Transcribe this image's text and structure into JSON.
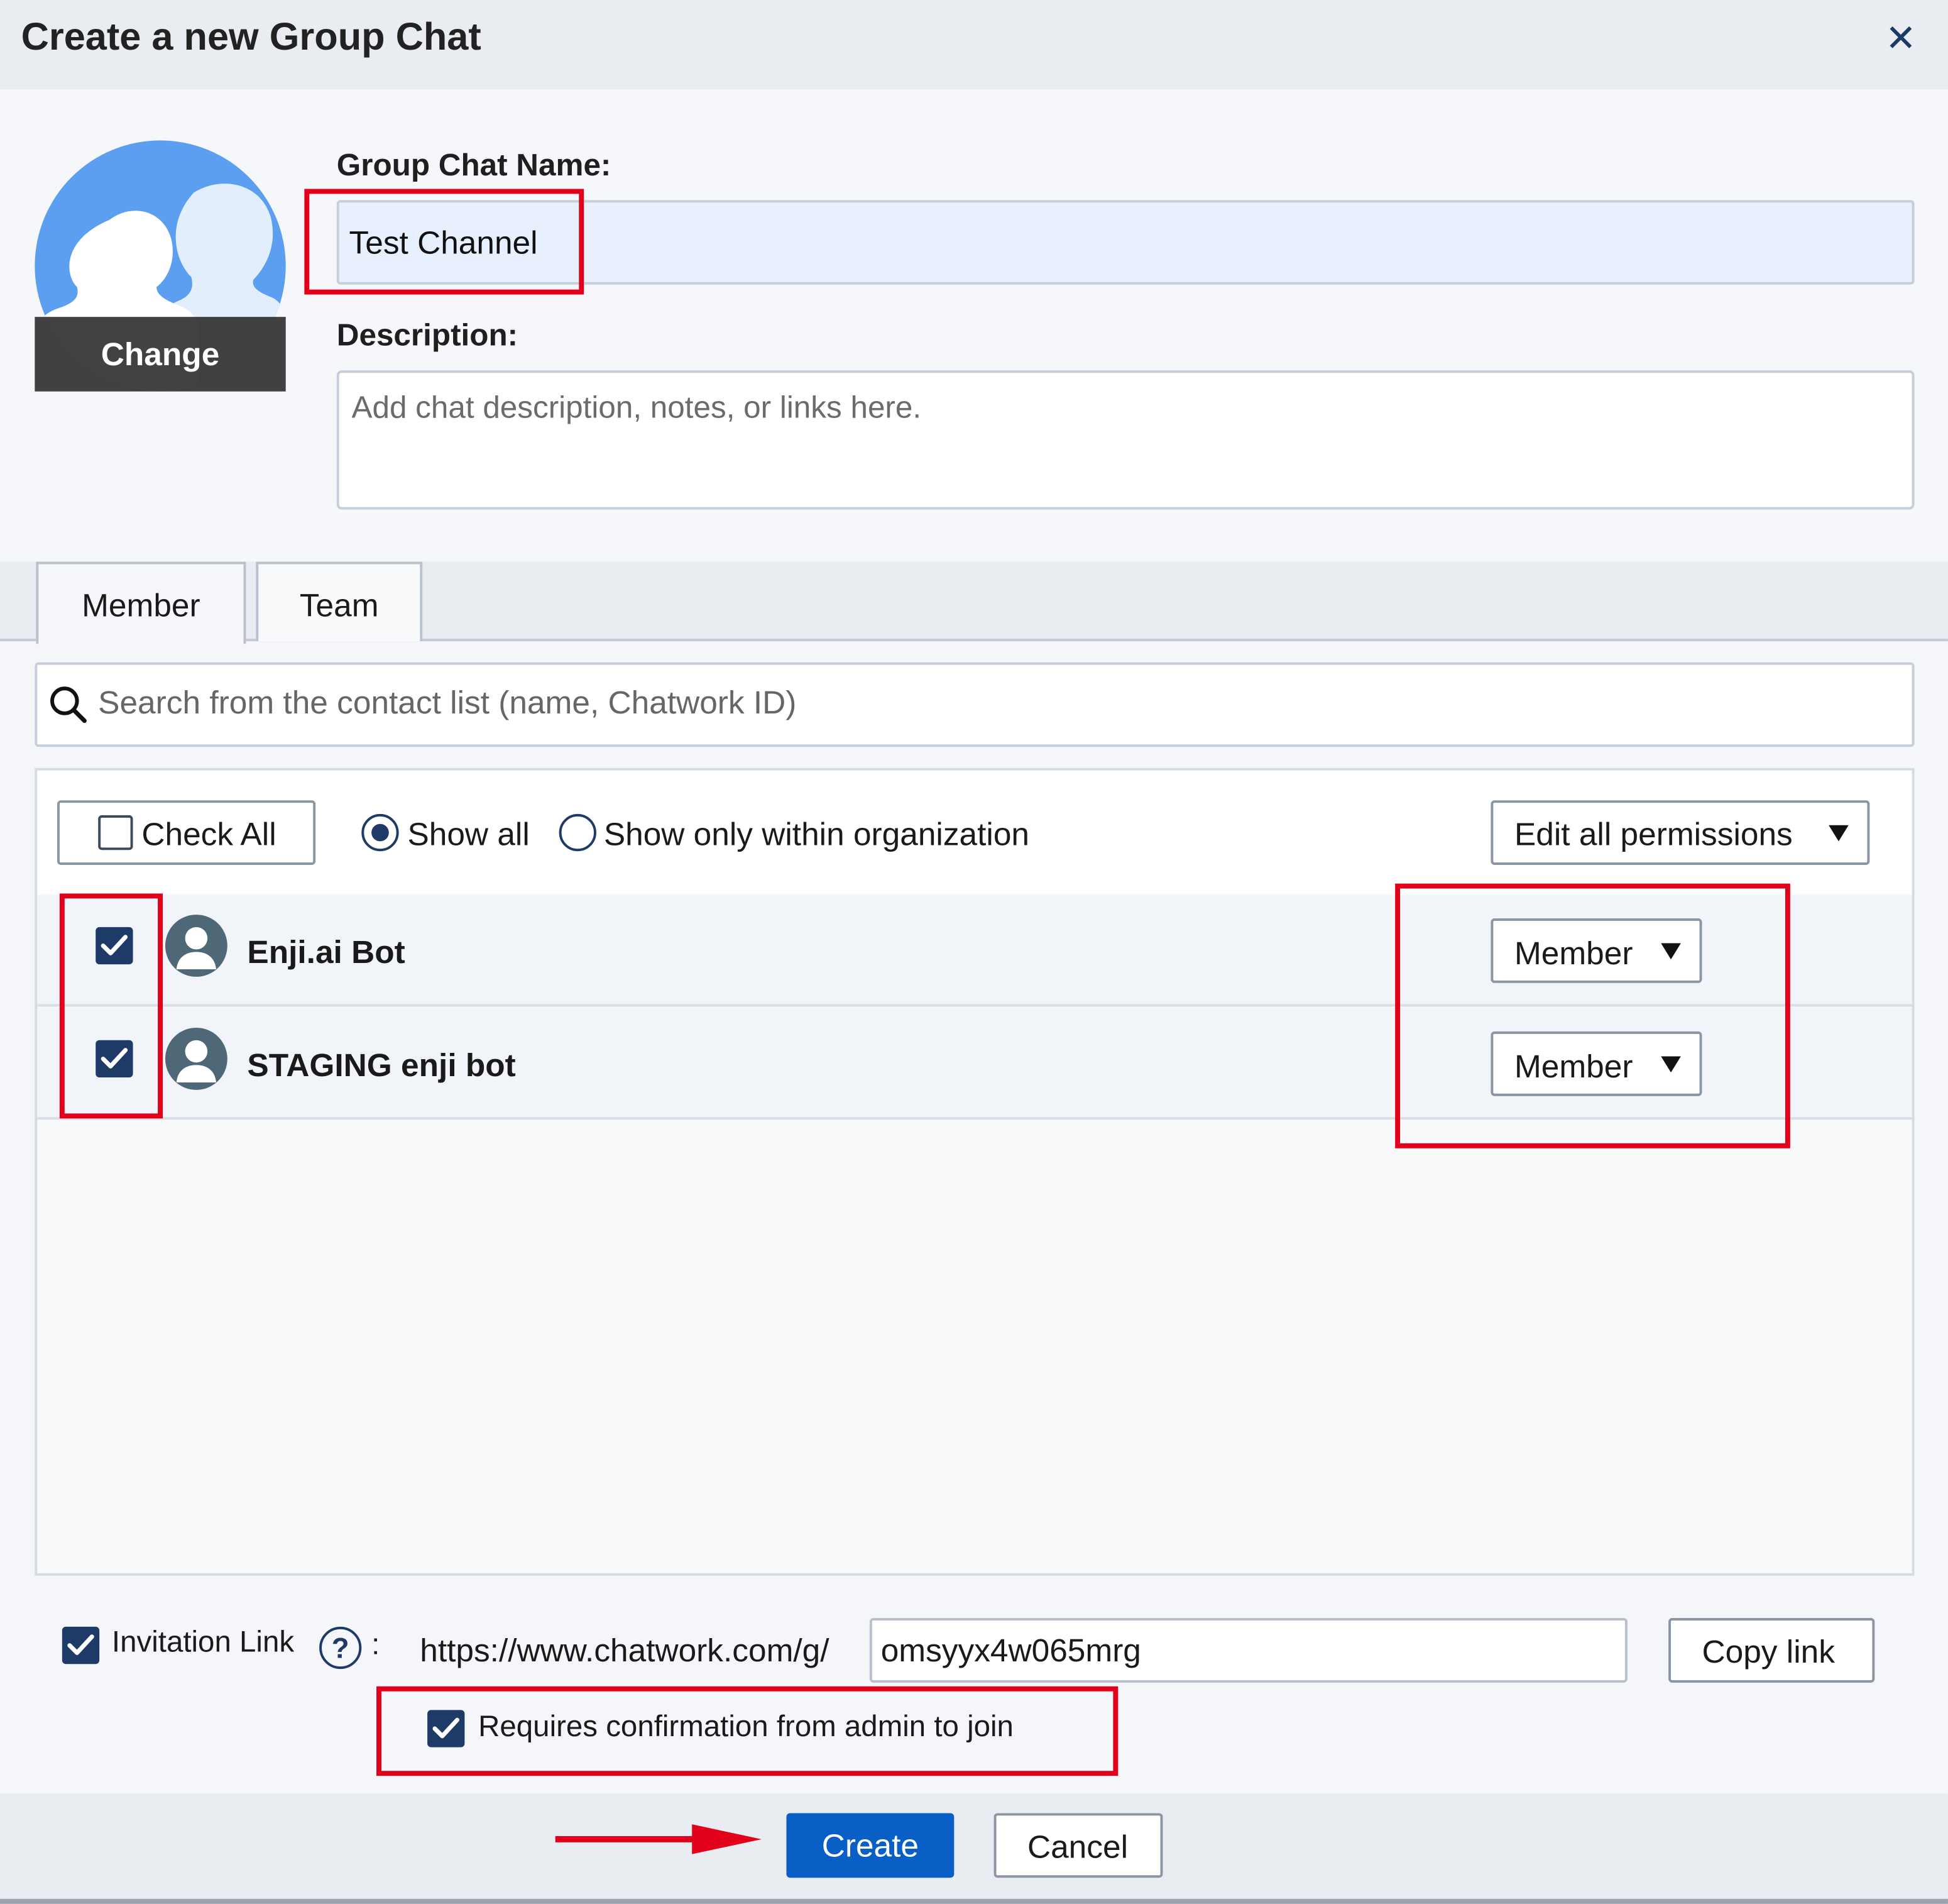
{
  "dialog": {
    "title": "Create a new Group Chat",
    "close_icon": "close-icon"
  },
  "avatar": {
    "change_label": "Change"
  },
  "form": {
    "name_label": "Group Chat Name:",
    "name_value": "Test Channel",
    "description_label": "Description:",
    "description_placeholder": "Add chat description, notes, or links here."
  },
  "tabs": [
    {
      "label": "Member",
      "active": true
    },
    {
      "label": "Team",
      "active": false
    }
  ],
  "search": {
    "placeholder": "Search from the contact list (name, Chatwork ID)"
  },
  "list_toolbar": {
    "check_all_label": "Check All",
    "show_all_label": "Show all",
    "show_org_label": "Show only within organization",
    "selected_filter": "Show all",
    "edit_permissions_label": "Edit all permissions"
  },
  "members": [
    {
      "name": "Enji.ai Bot",
      "checked": true,
      "role": "Member"
    },
    {
      "name": "STAGING enji bot",
      "checked": true,
      "role": "Member"
    }
  ],
  "invitation": {
    "enabled": true,
    "label": "Invitation Link",
    "colon": ":",
    "url_prefix": "https://www.chatwork.com/g/",
    "link_code": "omsyyx4w065mrg",
    "copy_label": "Copy link",
    "confirm_label": "Requires confirmation from admin to join",
    "confirm_checked": true
  },
  "footer": {
    "create_label": "Create",
    "cancel_label": "Cancel"
  },
  "colors": {
    "primary": "#0a5fc7",
    "checkbox": "#1e3a66",
    "annotation": "#e3001b"
  }
}
